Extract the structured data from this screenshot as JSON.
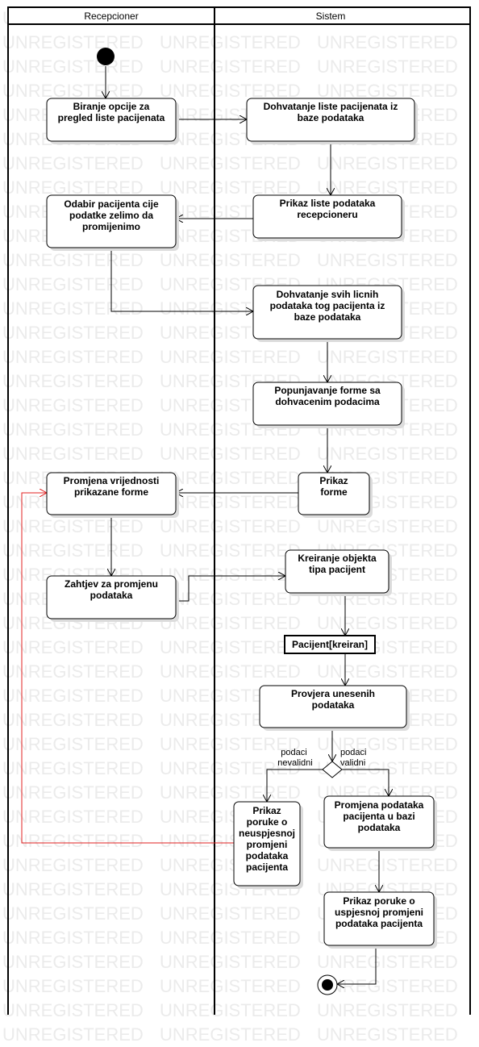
{
  "watermark": "UNREGISTERED",
  "lanes": [
    {
      "title": "Recepcioner"
    },
    {
      "title": "Sistem"
    }
  ],
  "nodes": [
    {
      "id": "n1",
      "lines": [
        "Biranje opcije za",
        "pregled liste pacijenata"
      ]
    },
    {
      "id": "n2",
      "lines": [
        "Dohvatanje liste pacijenata iz",
        "baze podataka"
      ]
    },
    {
      "id": "n3",
      "lines": [
        "Prikaz liste podataka",
        "recepcioneru"
      ]
    },
    {
      "id": "n4",
      "lines": [
        "Odabir pacijenta cije",
        "podatke zelimo da",
        "promijenimo"
      ]
    },
    {
      "id": "n5",
      "lines": [
        "Dohvatanje svih licnih",
        "podataka tog pacijenta iz",
        "baze podataka"
      ]
    },
    {
      "id": "n6",
      "lines": [
        "Popunjavanje forme sa",
        "dohvacenim podacima"
      ]
    },
    {
      "id": "n7",
      "lines": [
        "Prikaz",
        "forme"
      ]
    },
    {
      "id": "n8",
      "lines": [
        "Promjena vrijednosti",
        "prikazane forme"
      ]
    },
    {
      "id": "n9",
      "lines": [
        "Zahtjev za promjenu",
        "podataka"
      ]
    },
    {
      "id": "n10",
      "lines": [
        "Kreiranje objekta",
        "tipa pacijent"
      ]
    },
    {
      "id": "obj",
      "lines": [
        "Pacijent[kreiran]"
      ]
    },
    {
      "id": "n11",
      "lines": [
        "Provjera unesenih",
        "podataka"
      ]
    },
    {
      "id": "n12",
      "lines": [
        "Prikaz",
        "poruke o",
        "neuspjesnoj",
        "promjeni",
        "podataka",
        "pacijenta"
      ]
    },
    {
      "id": "n13",
      "lines": [
        "Promjena podataka",
        "pacijenta u bazi",
        "podataka"
      ]
    },
    {
      "id": "n14",
      "lines": [
        "Prikaz poruke o",
        "uspjesnoj promjeni",
        "podataka pacijenta"
      ]
    }
  ],
  "guards": [
    {
      "id": "g_invalid",
      "lines": [
        "podaci",
        "nevalidni"
      ]
    },
    {
      "id": "g_valid",
      "lines": [
        "podaci",
        "validni"
      ]
    }
  ],
  "colors": {
    "watermark": "#ebebeb",
    "return_flow": "#e02020"
  }
}
